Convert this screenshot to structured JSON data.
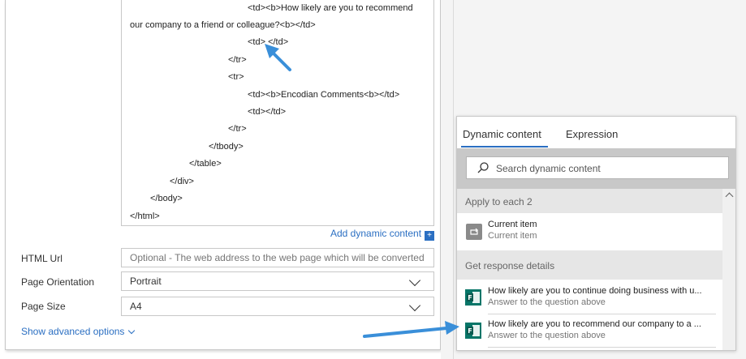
{
  "code_lines": [
    "<td><b>How likely are you to recommend",
    "our company to a friend or colleague?<b></td>",
    "<td> </td>",
    "</tr>",
    "<tr>",
    "<td><b>Encodian Comments<b></td>",
    "<td></td>",
    "</tr>",
    "</tbody>",
    "</table>",
    "</div>",
    "</body>",
    "</html>"
  ],
  "add_dynamic_content": {
    "label": "Add dynamic content",
    "plus": "+"
  },
  "fields": [
    {
      "label": "HTML Url",
      "value": "Optional - The web address to the web page which will be converted",
      "is_placeholder": true
    },
    {
      "label": "Page Orientation",
      "value": "Portrait",
      "is_dropdown": true
    },
    {
      "label": "Page Size",
      "value": "A4",
      "is_dropdown": true
    }
  ],
  "show_advanced": "Show advanced options",
  "dynamic_panel": {
    "tabs": [
      "Dynamic content",
      "Expression"
    ],
    "active_tab": "Dynamic content",
    "search_placeholder": "Search dynamic content",
    "sections": [
      {
        "title": "Apply to each 2",
        "items": [
          {
            "title": "Current item",
            "subtitle": "Current item",
            "icon": "loop-icon"
          }
        ]
      },
      {
        "title": "Get response details",
        "items": [
          {
            "title": "How likely are you to continue doing business with u...",
            "subtitle": "Answer to the question above",
            "icon": "forms-icon"
          },
          {
            "title": "How likely are you to recommend our company to a ...",
            "subtitle": "Answer to the question above",
            "icon": "forms-icon"
          }
        ]
      }
    ]
  },
  "colors": {
    "accent": "#2b6fc2",
    "arrow": "#3a8fd9",
    "forms_green": "#077568"
  }
}
